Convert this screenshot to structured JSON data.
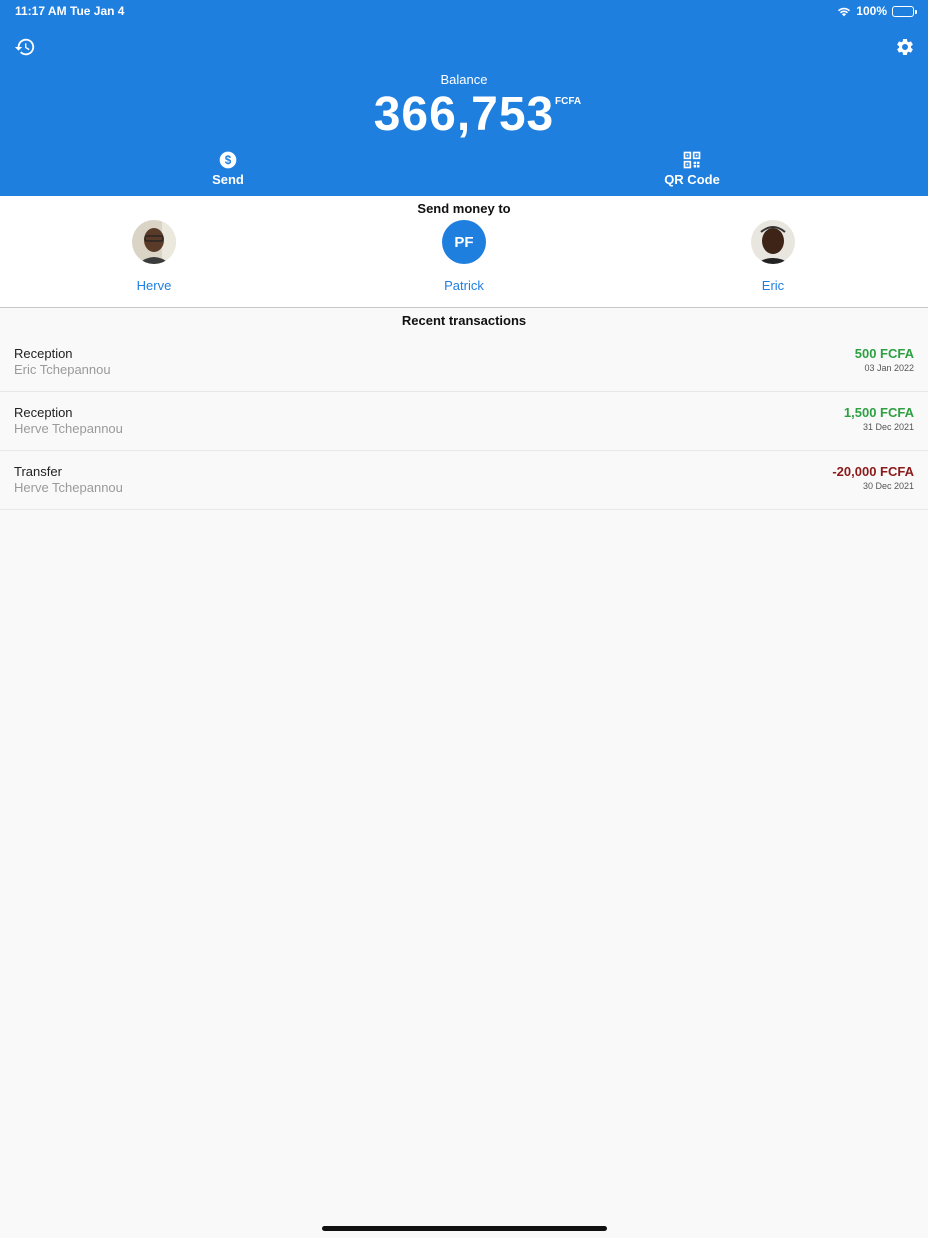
{
  "status_bar": {
    "time": "11:17 AM",
    "date": "Tue Jan 4",
    "battery": "100%"
  },
  "header": {
    "balance_label": "Balance",
    "balance_amount": "366,753",
    "balance_currency": "FCFA",
    "actions": [
      {
        "label": "Send",
        "icon": "dollar-circle-icon"
      },
      {
        "label": "QR Code",
        "icon": "qr-code-icon"
      }
    ]
  },
  "send_money": {
    "title": "Send money to",
    "contacts": [
      {
        "name": "Herve",
        "avatar": "photo"
      },
      {
        "name": "Patrick",
        "avatar": "initials",
        "initials": "PF"
      },
      {
        "name": "Eric",
        "avatar": "photo"
      }
    ]
  },
  "recent": {
    "title": "Recent transactions",
    "transactions": [
      {
        "type": "Reception",
        "name": "Eric Tchepannou",
        "amount": "500 FCFA",
        "date": "03 Jan 2022",
        "direction": "in"
      },
      {
        "type": "Reception",
        "name": "Herve Tchepannou",
        "amount": "1,500 FCFA",
        "date": "31 Dec 2021",
        "direction": "in"
      },
      {
        "type": "Transfer",
        "name": "Herve Tchepannou",
        "amount": "-20,000 FCFA",
        "date": "30 Dec 2021",
        "direction": "out"
      }
    ]
  },
  "colors": {
    "primary": "#1f7fdf",
    "positive": "#2ea043",
    "negative": "#8b1a1a"
  }
}
